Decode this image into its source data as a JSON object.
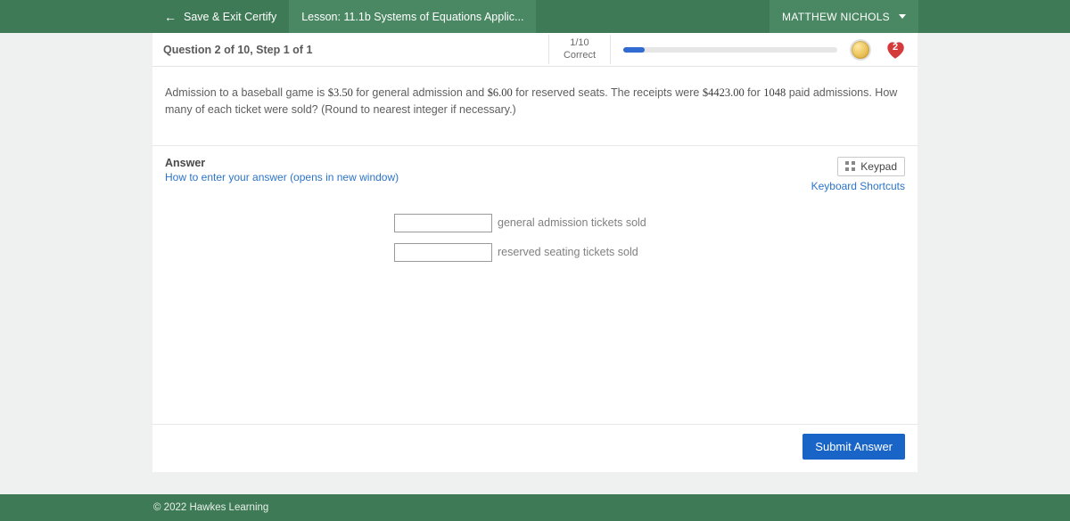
{
  "topbar": {
    "save_exit_label": "Save & Exit Certify",
    "lesson_label": "Lesson: 11.1b Systems of Equations Applic...",
    "user_name": "MATTHEW NICHOLS"
  },
  "question_header": {
    "title": "Question 2 of 10, Step 1 of 1",
    "correct_fraction": "1/10",
    "correct_label": "Correct",
    "progress_percent": 10,
    "lives": "2"
  },
  "question": {
    "p1a": "Admission to a baseball game is ",
    "price1": "$3.50",
    "p1b": " for general admission and ",
    "price2": "$6.00",
    "p1c": " for reserved seats.  The receipts were ",
    "total": "$4423.00",
    "p1d": " for ",
    "count": "1048",
    "p1e": " paid admissions.  How many of each ticket were sold?  (Round to nearest integer if necessary.)"
  },
  "answer": {
    "label": "Answer",
    "help": "How to enter your answer (opens in new window)",
    "keypad": "Keypad",
    "shortcuts": "Keyboard Shortcuts",
    "input1_suffix": "general admission tickets sold",
    "input2_suffix": "reserved seating tickets sold",
    "submit": "Submit Answer"
  },
  "footer": {
    "copyright": "© 2022 Hawkes Learning"
  }
}
